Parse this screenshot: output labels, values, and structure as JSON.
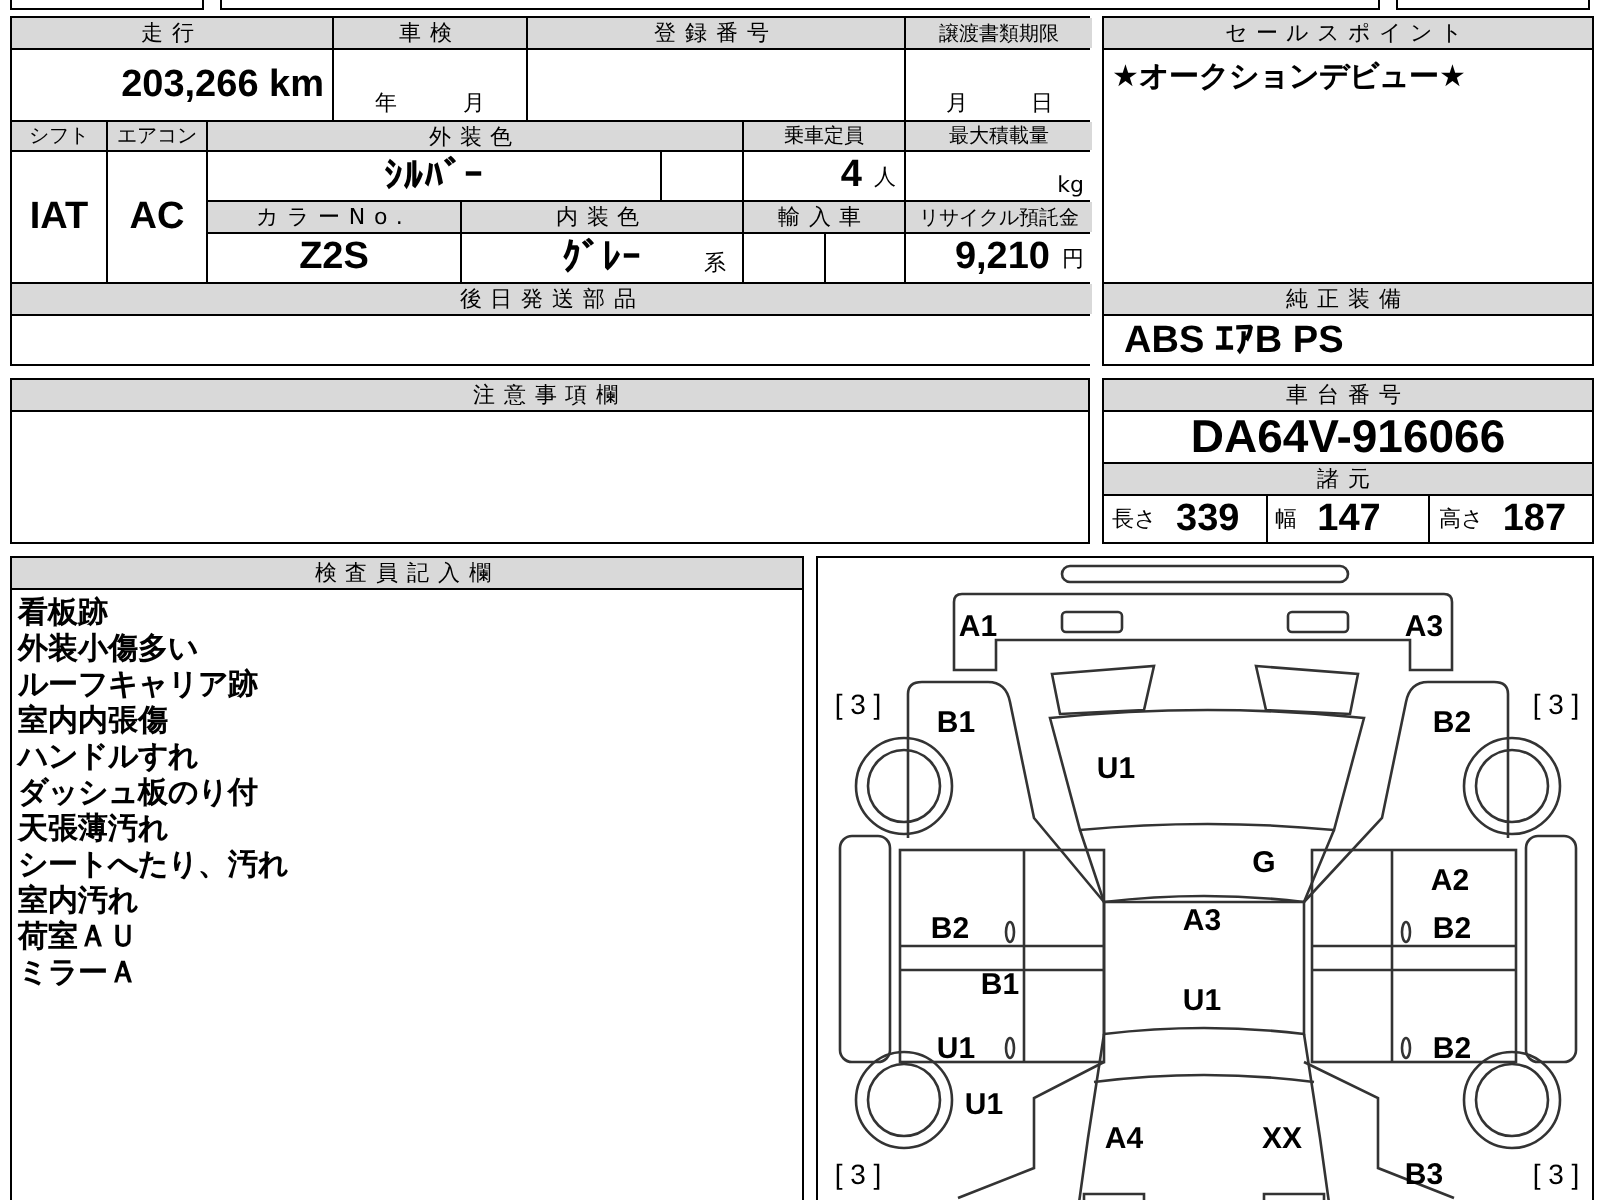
{
  "summary": {
    "mileage": {
      "label": "走行",
      "value": "203,266",
      "unit": "km"
    },
    "inspection": {
      "label": "車検",
      "year_unit": "年",
      "month_unit": "月"
    },
    "registration_number": {
      "label": "登録番号"
    },
    "transfer_document_deadline": {
      "label": "譲渡書類期限",
      "month_unit": "月",
      "day_unit": "日"
    },
    "shift": {
      "label": "シフト",
      "value": "IAT"
    },
    "air_conditioner": {
      "label": "エアコン",
      "value": "AC"
    },
    "exterior_color": {
      "label": "外装色",
      "value": "ｼﾙﾊﾞｰ"
    },
    "capacity": {
      "label": "乗車定員",
      "value": "4",
      "unit": "人"
    },
    "max_load": {
      "label": "最大積載量",
      "unit": "kg"
    },
    "color_number": {
      "label": "カラーNo.",
      "value": "Z2S"
    },
    "interior_color": {
      "label": "内装色",
      "value": "ｸﾞﾚｰ",
      "suffix": "系"
    },
    "imported": {
      "label": "輸入車"
    },
    "recycling_deposit": {
      "label": "リサイクル預託金",
      "value": "9,210",
      "unit": "円"
    },
    "parts_sent_later": {
      "label": "後日発送部品"
    }
  },
  "sales_point": {
    "label": "セールスポイント",
    "text": "★オークションデビュー★"
  },
  "standard_equipment": {
    "label": "純正装備",
    "value": "ABS ｴｱB PS"
  },
  "notes": {
    "label": "注意事項欄"
  },
  "chassis": {
    "label": "車台番号",
    "value": "DA64V-916066"
  },
  "specs": {
    "label": "諸元",
    "items": [
      {
        "label": "長さ",
        "value": "339"
      },
      {
        "label": "幅",
        "value": "147"
      },
      {
        "label": "高さ",
        "value": "187"
      }
    ]
  },
  "inspector_notes": {
    "label": "検査員記入欄",
    "lines": [
      "看板跡",
      "外装小傷多い",
      "ルーフキャリア跡",
      "室内内張傷",
      "ハンドルすれ",
      "ダッシュ板のり付",
      "天張薄汚れ",
      "シートへたり、汚れ",
      "室内汚れ",
      "荷室ＡＵ",
      "ミラーＡ"
    ]
  },
  "diagram": {
    "tire_treads": [
      "[ 3 ]",
      "[ 3 ]",
      "[ 3 ]",
      "[ 3 ]"
    ],
    "marks": [
      "A1",
      "A3",
      "B1",
      "B2",
      "U1",
      "G",
      "A2",
      "B2",
      "A3",
      "B2",
      "B1",
      "U1",
      "U1",
      "B2",
      "U1",
      "A4",
      "XX",
      "B3"
    ]
  }
}
